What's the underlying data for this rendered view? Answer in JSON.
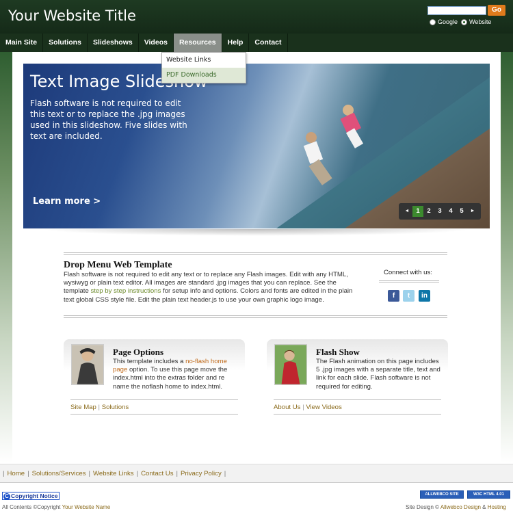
{
  "header": {
    "title": "Your Website Title",
    "search_button": "Go",
    "radio_google": "Google",
    "radio_website": "Website"
  },
  "nav": {
    "items": [
      "Main Site",
      "Solutions",
      "Slideshows",
      "Videos",
      "Resources",
      "Help",
      "Contact"
    ],
    "active": "Resources"
  },
  "dropdown": {
    "items": [
      "Website Links",
      "PDF Downloads"
    ]
  },
  "slideshow": {
    "title": "Text Image Slideshow",
    "text": "Flash software is not required to edit this text or to replace the .jpg images used in this slideshow. Five slides with text are included.",
    "learn_more": "Learn more >",
    "controls": {
      "prev": "◄",
      "pages": [
        "1",
        "2",
        "3",
        "4",
        "5"
      ],
      "active_page": "1",
      "next": "►"
    }
  },
  "feature": {
    "heading": "Drop Menu Web Template",
    "text_before": "Flash software is not required to edit any text or to replace any Flash images. Edit with any HTML, wysiwyg or plain text editor. All images are standard .jpg images that you can replace. See the template ",
    "link": "step by step instructions",
    "text_after": " for setup info and options. Colors and fonts are edited in the plain text global CSS style file. Edit the plain text header.js to use your own graphic logo image.",
    "connect_label": "Connect with us:",
    "social": [
      "f",
      "t",
      "in"
    ]
  },
  "box_left": {
    "title": "Page Options",
    "text_before": "This template includes a ",
    "link": "no-flash home page",
    "text_after": " option. To use this page move the index.html into the extras folder and re name the noflash home to index.html.",
    "links": [
      "Site Map",
      "Solutions"
    ],
    "separator": "|"
  },
  "box_right": {
    "title": "Flash Show",
    "text": "The Flash animation on this page includes 5 .jpg images with a separate title, text and link for each slide. Flash software is not required for editing.",
    "links": [
      "About Us",
      "View Videos"
    ],
    "separator": "|"
  },
  "footer": {
    "nav": [
      "Home",
      "Solutions/Services",
      "Website Links",
      "Contact Us",
      "Privacy Policy"
    ],
    "separator": "|",
    "copyright_notice": "Copyright Notice",
    "copyright_icon": "C",
    "all_contents_prefix": "All Contents ©Copyright ",
    "all_contents_link": "Your Website Name",
    "badge1": "ALLWEBCO SITE",
    "badge2": "W3C HTML 4.01",
    "site_design_prefix": "Site Design © ",
    "site_design_link1": "Allwebco Design",
    "site_design_amp": " & ",
    "site_design_link2": "Hosting"
  },
  "colors": {
    "header_bg": "#1e3a22",
    "nav_bg": "#1a311c",
    "nav_active": "#8a8f8a",
    "go_button": "#e07b1c",
    "link": "#8a6a1a",
    "green_link": "#6b8a2a",
    "slide_active": "#3c8a2e"
  }
}
